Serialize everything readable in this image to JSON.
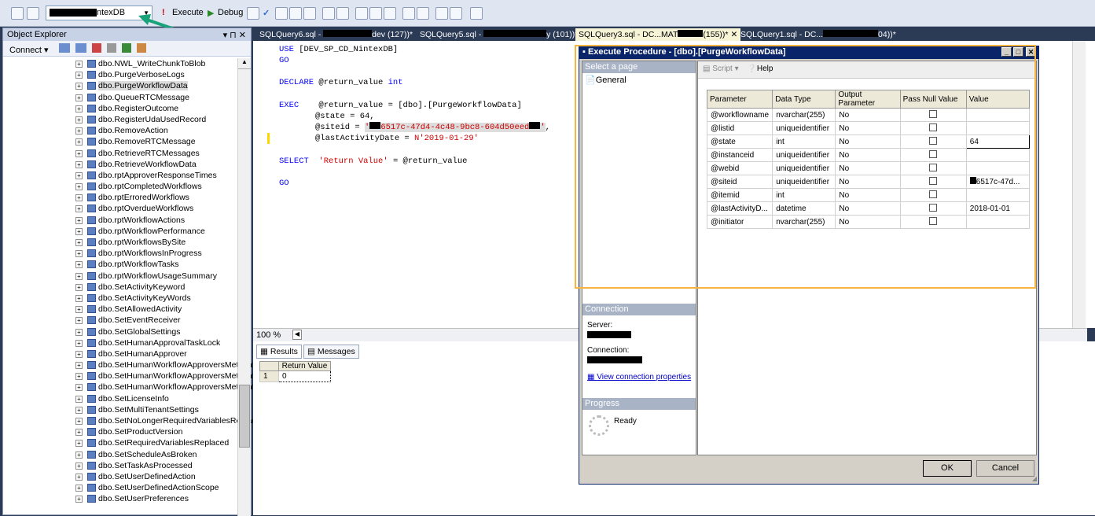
{
  "toolbar": {
    "db_name": "ntexDB",
    "execute": "Execute",
    "debug": "Debug"
  },
  "object_explorer": {
    "title": "Object Explorer",
    "pin": "▾ ⊓ ✕",
    "connect": "Connect",
    "items": [
      "dbo.NWL_WriteChunkToBlob",
      "dbo.PurgeVerboseLogs",
      "dbo.PurgeWorkflowData",
      "dbo.QueueRTCMessage",
      "dbo.RegisterOutcome",
      "dbo.RegisterUdaUsedRecord",
      "dbo.RemoveAction",
      "dbo.RemoveRTCMessage",
      "dbo.RetrieveRTCMessages",
      "dbo.RetrieveWorkflowData",
      "dbo.rptApproverResponseTimes",
      "dbo.rptCompletedWorkflows",
      "dbo.rptErroredWorkflows",
      "dbo.rptOverdueWorkflows",
      "dbo.rptWorkflowActions",
      "dbo.rptWorkflowPerformance",
      "dbo.rptWorkflowsBySite",
      "dbo.rptWorkflowsInProgress",
      "dbo.rptWorkflowTasks",
      "dbo.rptWorkflowUsageSummary",
      "dbo.SetActivityKeyword",
      "dbo.SetActivityKeyWords",
      "dbo.SetAllowedActivity",
      "dbo.SetEventReceiver",
      "dbo.SetGlobalSettings",
      "dbo.SetHumanApprovalTaskLock",
      "dbo.SetHumanApprover",
      "dbo.SetHumanWorkflowApproversMetadata",
      "dbo.SetHumanWorkflowApproversMetadata_",
      "dbo.SetHumanWorkflowApproversMetadatal",
      "dbo.SetLicenseInfo",
      "dbo.SetMultiTenantSettings",
      "dbo.SetNoLongerRequiredVariablesReplaced",
      "dbo.SetProductVersion",
      "dbo.SetRequiredVariablesReplaced",
      "dbo.SetScheduleAsBroken",
      "dbo.SetTaskAsProcessed",
      "dbo.SetUserDefinedAction",
      "dbo.SetUserDefinedActionScope",
      "dbo.SetUserPreferences"
    ]
  },
  "tabs": [
    {
      "label": "SQLQuery6.sql - ",
      "label2": "dev (127))*"
    },
    {
      "label": "SQLQuery5.sql - ",
      "label2": "y (101))*"
    },
    {
      "label": "SQLQuery3.sql - DC...MAT",
      "label2": "(155))*",
      "close": "✕"
    },
    {
      "label": "SQLQuery1.sql - DC...",
      "label2": "04))*"
    }
  ],
  "editor": {
    "line1_kw": "USE",
    "line1": " [DEV_SP_CD_NintexDB]",
    "line2": "GO",
    "line3_kw": "DECLARE",
    "line3a": " @return_value ",
    "line3_type": "int",
    "line4_kw": "EXEC",
    "line4": "    @return_value = [dbo].[PurgeWorkflowData]",
    "line5": "@state = 64,",
    "line6": "@siteid = ",
    "line6_str": "6517c-47d4-4c48-9bc8-604d50eed",
    "line7": "@lastActivityDate = ",
    "line7_str": "N'2019-01-29'",
    "line8_kw": "SELECT",
    "line8_str": "'Return Value'",
    "line8b": " = @return_value",
    "line9": "GO"
  },
  "zoom": "100 %",
  "results": {
    "tab_results": "Results",
    "tab_messages": "Messages",
    "column": "Return Value",
    "row_num": "1",
    "value": "0"
  },
  "dialog": {
    "title": "Execute Procedure - [dbo].[PurgeWorkflowData]",
    "select_page": "Select a page",
    "general": "General",
    "script": "Script",
    "help": "Help",
    "connection": "Connection",
    "server_label": "Server:",
    "connection_label": "Connection:",
    "view_props": "View connection properties",
    "progress": "Progress",
    "ready": "Ready",
    "ok": "OK",
    "cancel": "Cancel",
    "headers": [
      "Parameter",
      "Data Type",
      "Output Parameter",
      "Pass Null Value",
      "Value"
    ],
    "rows": [
      {
        "p": "@workflowname",
        "t": "nvarchar(255)",
        "o": "No",
        "v": ""
      },
      {
        "p": "@listid",
        "t": "uniqueidentifier",
        "o": "No",
        "v": ""
      },
      {
        "p": "@state",
        "t": "int",
        "o": "No",
        "v": "64"
      },
      {
        "p": "@instanceid",
        "t": "uniqueidentifier",
        "o": "No",
        "v": ""
      },
      {
        "p": "@webid",
        "t": "uniqueidentifier",
        "o": "No",
        "v": ""
      },
      {
        "p": "@siteid",
        "t": "uniqueidentifier",
        "o": "No",
        "v": "6517c-47d..."
      },
      {
        "p": "@itemid",
        "t": "int",
        "o": "No",
        "v": ""
      },
      {
        "p": "@lastActivityD...",
        "t": "datetime",
        "o": "No",
        "v": "2018-01-01"
      },
      {
        "p": "@initiator",
        "t": "nvarchar(255)",
        "o": "No",
        "v": ""
      }
    ]
  }
}
